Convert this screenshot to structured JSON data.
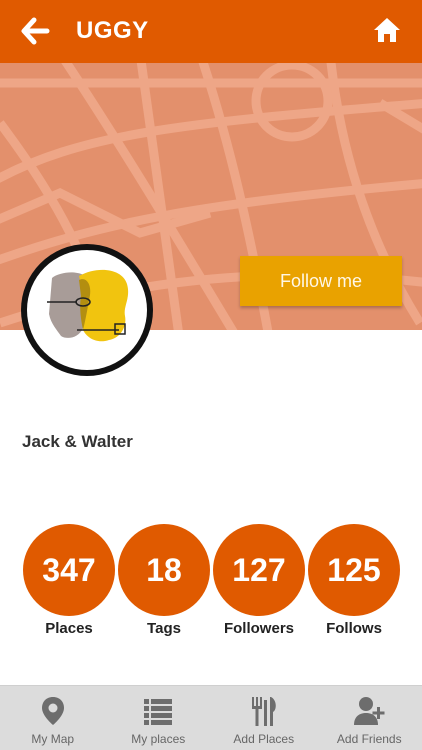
{
  "app": {
    "title": "UGGY"
  },
  "colors": {
    "primary": "#e05a00",
    "accent": "#e9a200",
    "cover": "#e3906c",
    "nav_bg": "#dcdcdc"
  },
  "icons": {
    "back": "arrow-left-icon",
    "home": "home-icon"
  },
  "profile": {
    "name": "Jack & Walter",
    "follow_label": "Follow me"
  },
  "stats": [
    {
      "value": "347",
      "label": "Places"
    },
    {
      "value": "18",
      "label": "Tags"
    },
    {
      "value": "127",
      "label": "Followers"
    },
    {
      "value": "125",
      "label": "Follows"
    }
  ],
  "nav": [
    {
      "label": "My Map",
      "icon": "map-pin-icon"
    },
    {
      "label": "My places",
      "icon": "list-icon"
    },
    {
      "label": "Add Places",
      "icon": "cutlery-icon"
    },
    {
      "label": "Add Friends",
      "icon": "add-user-icon"
    }
  ]
}
